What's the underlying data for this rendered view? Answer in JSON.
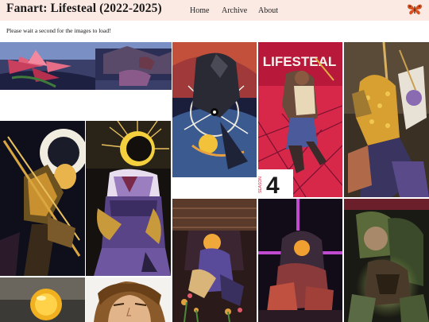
{
  "site": {
    "title": "Fanart: Lifesteal (2022-2025)",
    "logo_icon": "butterfly-icon",
    "logo_color": "#d8501e",
    "header_bg": "#fbe9e3"
  },
  "nav": {
    "home": "Home",
    "archive": "Archive",
    "about": "About"
  },
  "notice": "Please wait a second for the images to load!",
  "gallery": {
    "poster_text": "LIFESTEAL",
    "poster_season_label": "SEASON",
    "poster_season_number": "4"
  }
}
